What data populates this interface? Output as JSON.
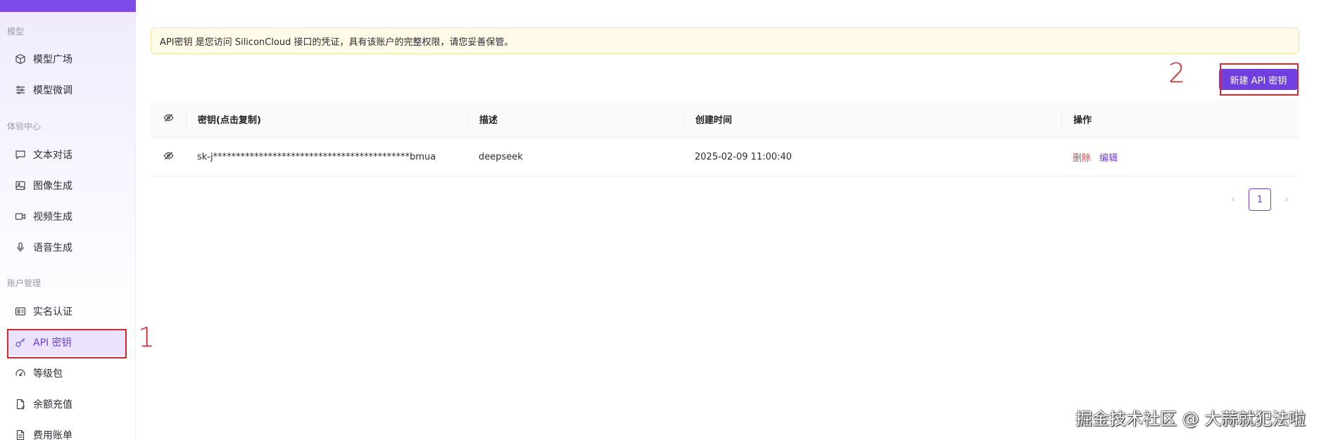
{
  "sidebar": {
    "groups": [
      {
        "title": "模型",
        "items": [
          {
            "label": "模型广场",
            "icon": "cube-icon"
          },
          {
            "label": "模型微调",
            "icon": "sliders-icon"
          }
        ]
      },
      {
        "title": "体验中心",
        "items": [
          {
            "label": "文本对话",
            "icon": "chat-icon"
          },
          {
            "label": "图像生成",
            "icon": "image-icon"
          },
          {
            "label": "视频生成",
            "icon": "video-icon"
          },
          {
            "label": "语音生成",
            "icon": "mic-icon"
          }
        ]
      },
      {
        "title": "账户管理",
        "items": [
          {
            "label": "实名认证",
            "icon": "id-card-icon"
          },
          {
            "label": "API 密钥",
            "icon": "key-icon",
            "active": true
          },
          {
            "label": "等级包",
            "icon": "gauge-icon"
          },
          {
            "label": "余额充值",
            "icon": "wallet-icon"
          },
          {
            "label": "费用账单",
            "icon": "bill-icon"
          }
        ]
      }
    ]
  },
  "notice": {
    "text": "API密钥 是您访问 SiliconCloud 接口的凭证，具有该账户的完整权限，请您妥善保管。"
  },
  "toolbar": {
    "new_key_label": "新建 API 密钥"
  },
  "table": {
    "headers": {
      "key": "密钥(点击复制)",
      "desc": "描述",
      "time": "创建时间",
      "ops": "操作"
    },
    "rows": [
      {
        "key": "sk-j*******************************************bmua",
        "desc": "deepseek",
        "time": "2025-02-09 11:00:40",
        "delete": "删除",
        "edit": "编辑"
      }
    ]
  },
  "pagination": {
    "current": "1"
  },
  "annotations": {
    "one": "1",
    "two": "2"
  },
  "watermark": "掘金技术社区 @ 大蒜就犯法啦",
  "colors": {
    "accent": "#6f3fe0",
    "danger": "#e5484d",
    "annotation": "#d9272e",
    "notice_bg": "#fffbe6"
  }
}
